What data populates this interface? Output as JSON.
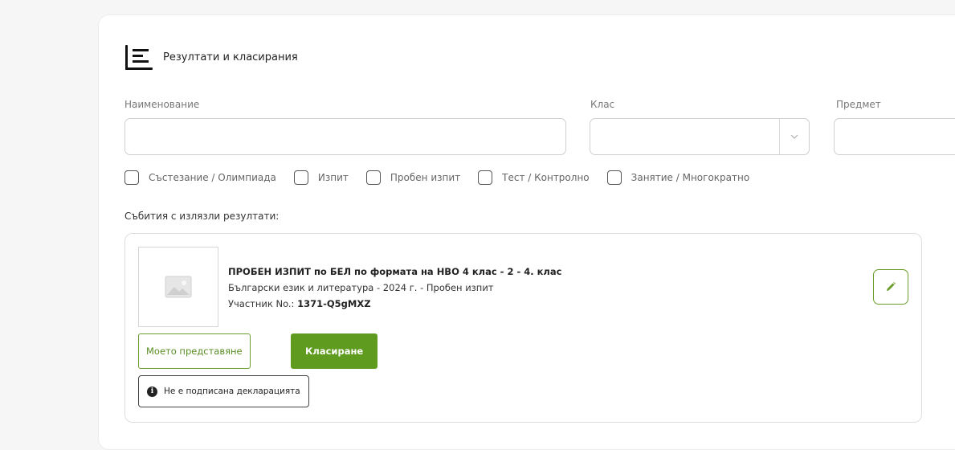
{
  "header": {
    "title": "Резултати и класирания",
    "icon": "chart-icon"
  },
  "filters": {
    "name_label": "Наименование",
    "name_value": "",
    "class_label": "Клас",
    "class_value": "",
    "subject_label": "Предмет",
    "subject_value": ""
  },
  "checkboxes": [
    {
      "label": "Състезание / Олимпиада",
      "checked": false
    },
    {
      "label": "Изпит",
      "checked": false
    },
    {
      "label": "Пробен изпит",
      "checked": false
    },
    {
      "label": "Тест / Контролно",
      "checked": false
    },
    {
      "label": "Занятие / Многократно",
      "checked": false
    }
  ],
  "events_label": "Събития с излязли резултати:",
  "event": {
    "title": "ПРОБЕН ИЗПИТ по БЕЛ по формата на НВО 4 клас - 2 - 4. клас",
    "subtitle": "Български език и литература - 2024 г. - Пробен изпит",
    "participant_label": "Участник No.:",
    "participant_id": "1371-Q5gMXZ",
    "my_submission_label": "Моето представяне",
    "ranking_label": "Класиране",
    "declaration_text": "Не е подписана декларацията"
  },
  "colors": {
    "accent": "#5f9b1f",
    "accent_border": "#6a9e2c"
  }
}
